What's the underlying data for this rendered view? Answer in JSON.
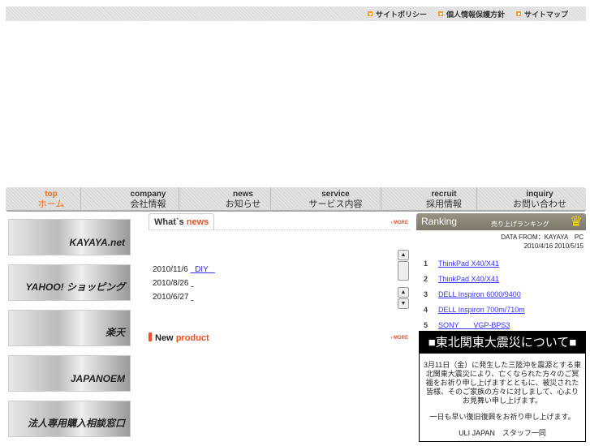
{
  "top_links": [
    "サイトポリシー",
    "個人情報保護方針",
    "サイトマップ"
  ],
  "nav": [
    {
      "en": "top",
      "jp": "ホーム"
    },
    {
      "en": "company",
      "jp": "会社情報"
    },
    {
      "en": "news",
      "jp": "お知らせ"
    },
    {
      "en": "service",
      "jp": "サービス内容"
    },
    {
      "en": "recruit",
      "jp": "採用情報"
    },
    {
      "en": "inquiry",
      "jp": "お問い合わせ"
    }
  ],
  "banners": [
    "KAYAYA.net",
    "YAHOO! ショッピング",
    "楽天",
    "JAPANOEM",
    "法人専用購入相談窓口"
  ],
  "news": {
    "title_a": "What`s ",
    "title_b": "news",
    "more": "› MORE",
    "items": [
      {
        "date": "2010/11/6",
        "link": "  DIY   "
      },
      {
        "date": "2010/8/26",
        "link": ""
      },
      {
        "date": "2010/6/27",
        "link": ""
      }
    ]
  },
  "product": {
    "title_a": "New ",
    "title_b": "product",
    "more": "› MORE"
  },
  "ranking": {
    "title": "Ranking",
    "subtitle": "売り上げランキング",
    "from": "DATA FROM：KAYAYA　PC",
    "period": "2010/4/16 2010/5/15",
    "items": [
      {
        "n": "1",
        "name": "ThinkPad X40/X41"
      },
      {
        "n": "2",
        "name": "ThinkPad X40/X41"
      },
      {
        "n": "3",
        "name": "DELL Inspiron 6000/9400"
      },
      {
        "n": "4",
        "name": "DELL Inspiron 700m/710m"
      },
      {
        "n": "5",
        "name": "SONY　　VGP-BPS3"
      }
    ]
  },
  "notice": {
    "title": "■東北関東大震災について■",
    "p1": "3月11日（金）に発生した三陸沖を震源とする東北関東大震災により、亡くなられた方々のご冥福をお祈り申し上げますとともに、被災された皆様、そのご家族の方々に対しまして、心よりお見舞い申し上げます。",
    "p2": "一日も早い復旧復興をお祈り申し上げます。",
    "p3": "ULI JAPAN　スタッフ一同"
  }
}
